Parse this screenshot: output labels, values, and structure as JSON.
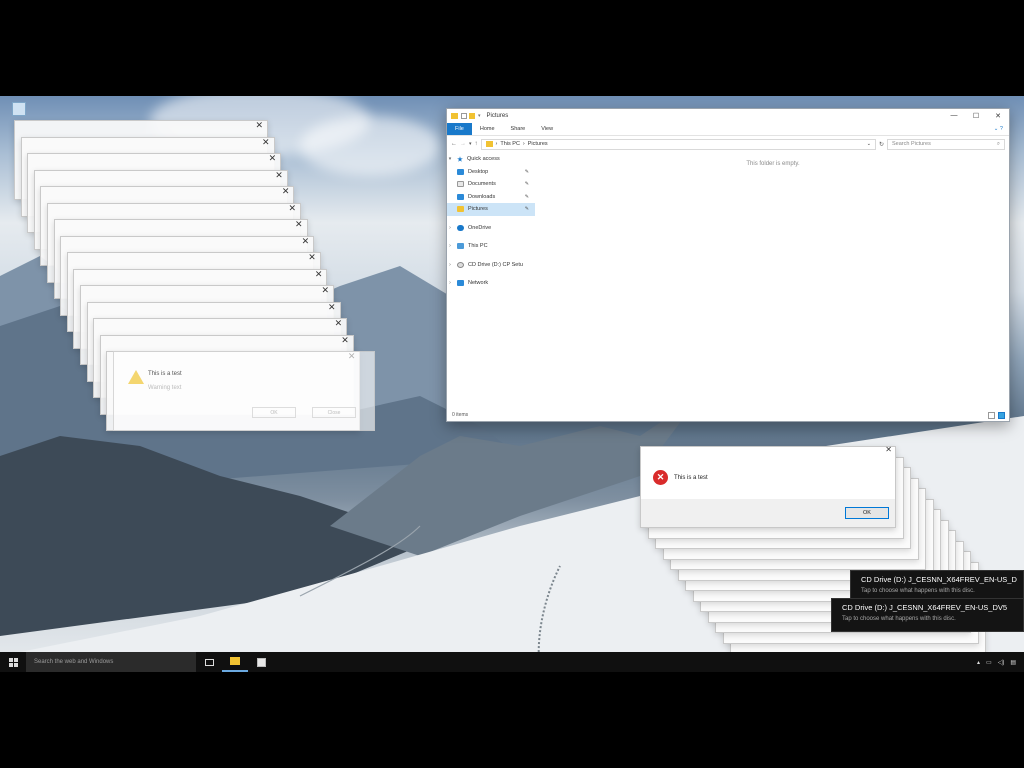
{
  "explorer": {
    "window_title": "Pictures",
    "ribbon_tabs": [
      "File",
      "Home",
      "Share",
      "View"
    ],
    "address_segments": [
      "This PC",
      "Pictures"
    ],
    "search_placeholder": "Search Pictures",
    "nav": {
      "quick_access": "Quick access",
      "desktop": "Desktop",
      "documents": "Documents",
      "downloads": "Downloads",
      "pictures": "Pictures",
      "onedrive": "OneDrive",
      "this_pc": "This PC",
      "cd_drive": "CD Drive (D:) CP Setu",
      "network": "Network"
    },
    "empty_message": "This folder is empty.",
    "status": "0 items"
  },
  "error_dialog": {
    "message": "This is a test",
    "ok_label": "OK"
  },
  "warning_dialog": {
    "title": "This is a test",
    "subtitle": "Warning text",
    "buttons": [
      "OK",
      "Close"
    ]
  },
  "toasts": [
    {
      "title": "CD Drive (D:) J_CESNN_X64FREV_EN-US_D",
      "subtitle": "Tap to choose what happens with this disc."
    },
    {
      "title": "CD Drive (D:) J_CESNN_X64FREV_EN-US_DV5",
      "subtitle": "Tap to choose what happens with this disc."
    }
  ],
  "taskbar": {
    "search_placeholder": "Search the web and Windows"
  },
  "colors": {
    "accent": "#1979ca",
    "error": "#d92b2b",
    "taskbar": "#101010"
  }
}
